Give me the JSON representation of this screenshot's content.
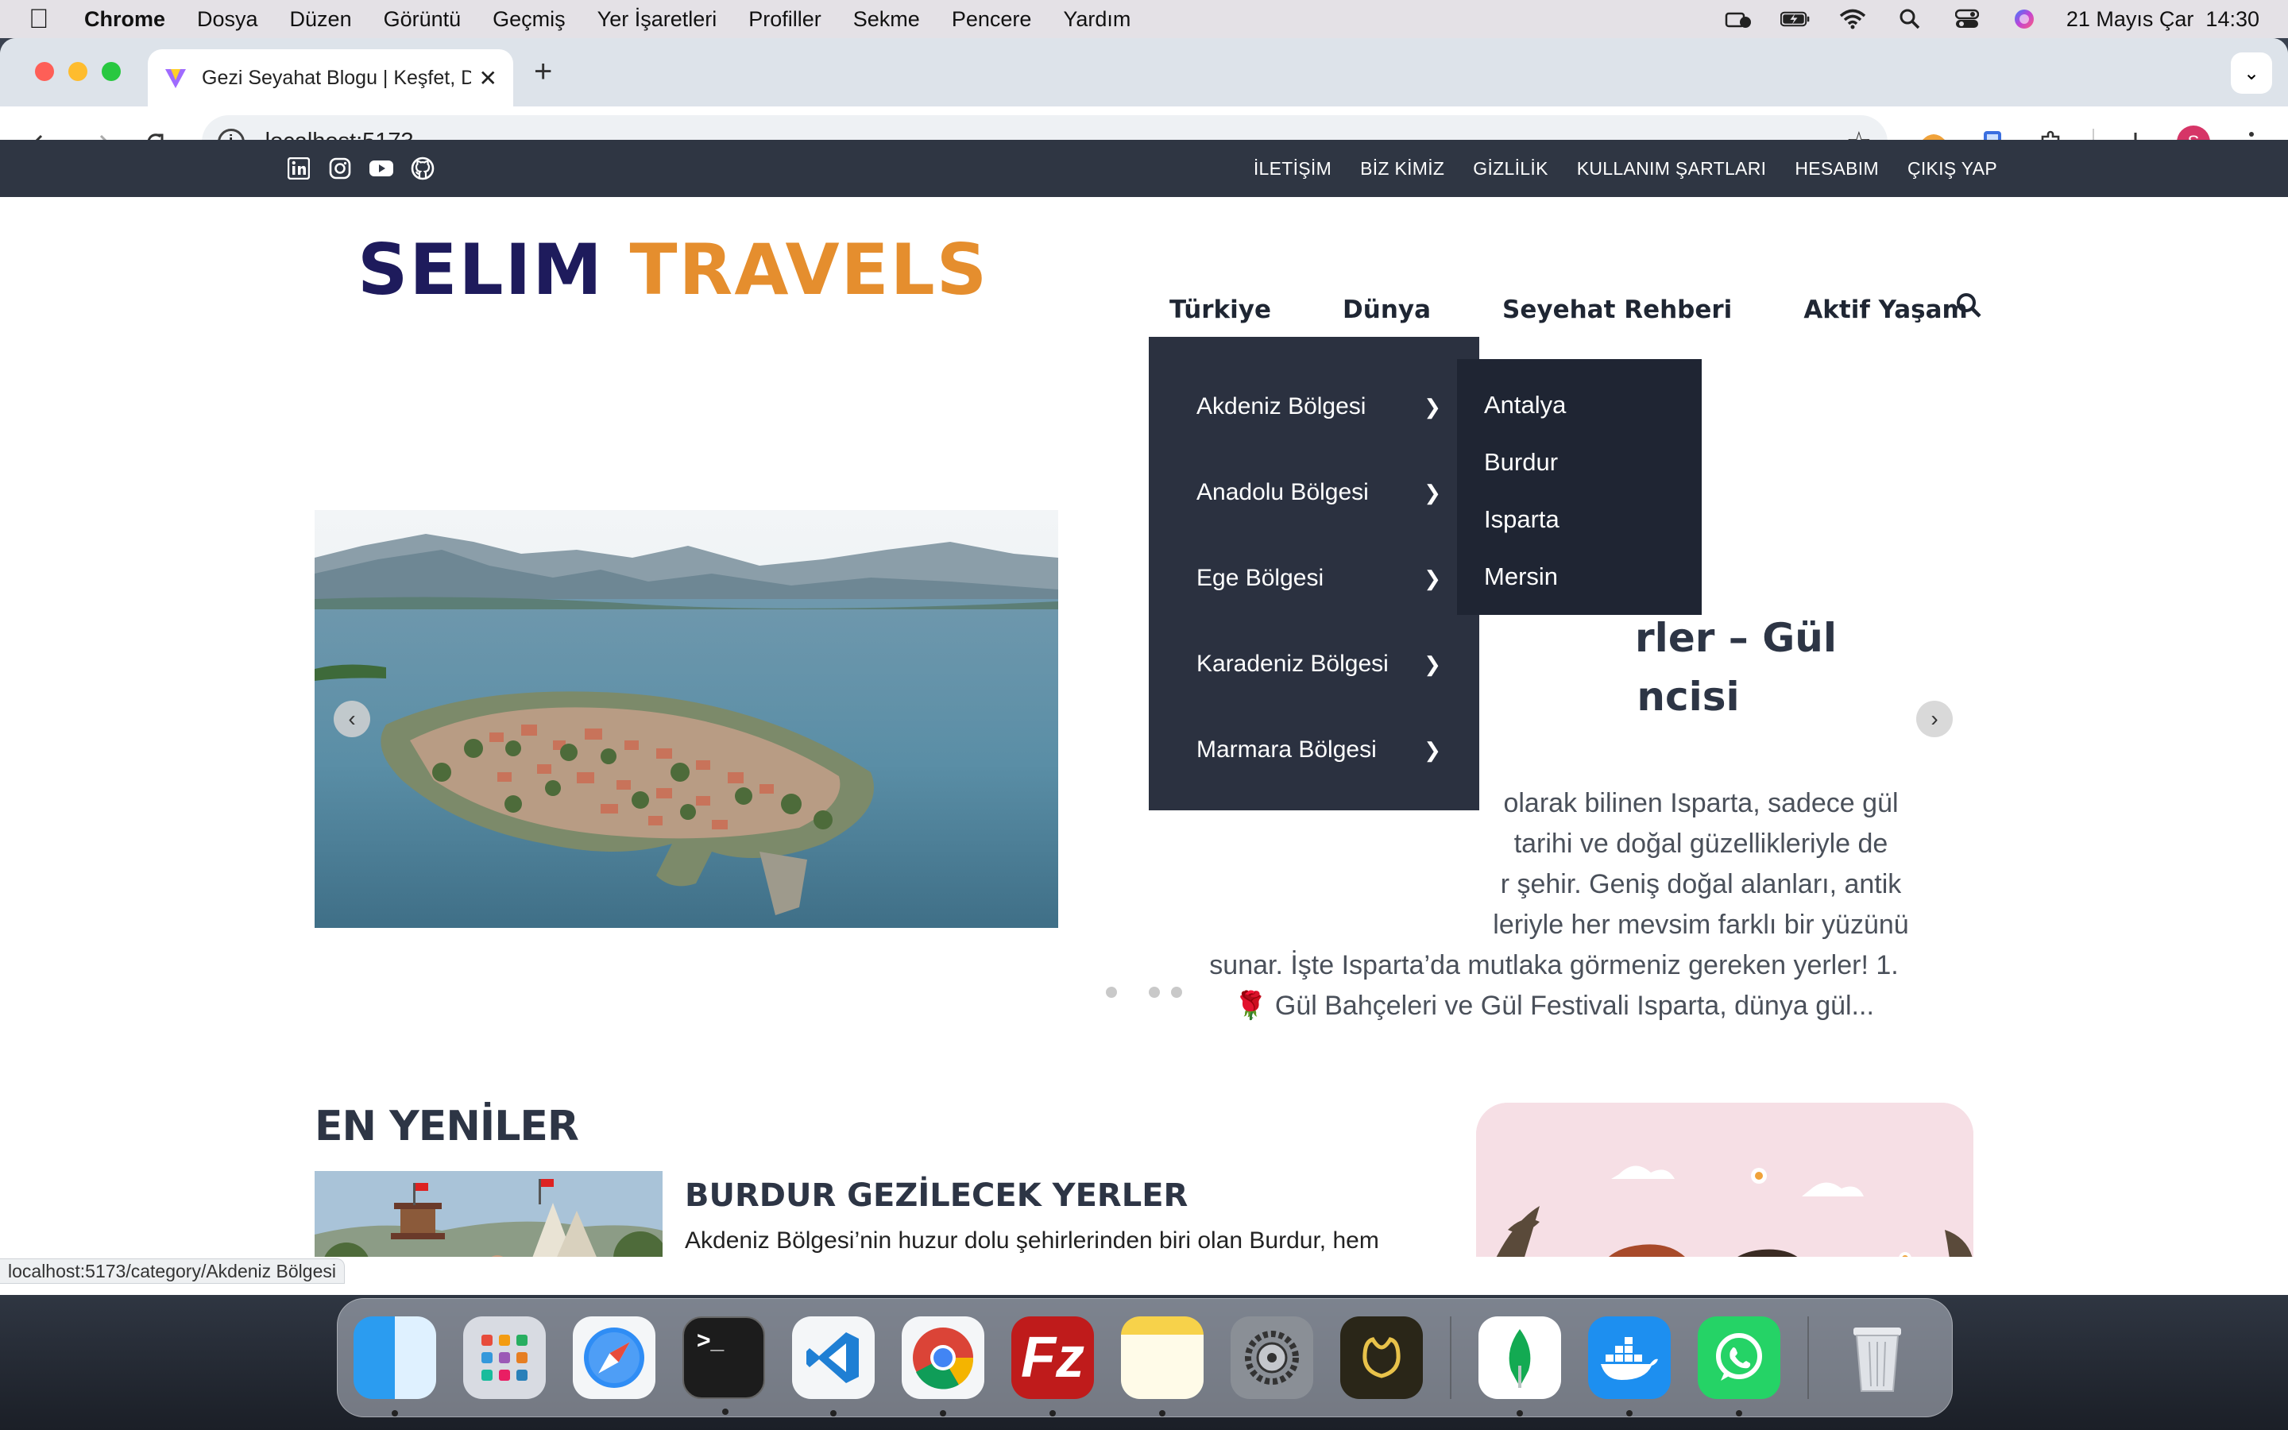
{
  "menubar": {
    "app": "Chrome",
    "items": [
      "Dosya",
      "Düzen",
      "Görüntü",
      "Geçmiş",
      "Yer İşaretleri",
      "Profiller",
      "Sekme",
      "Pencere",
      "Yardım"
    ],
    "clock": "21 Mayıs Çar  14:30"
  },
  "browser": {
    "tab_title": "Gezi Seyahat Blogu | Keşfet, D",
    "url": "localhost:5173",
    "profile_initial": "S",
    "status_url": "localhost:5173/category/Akdeniz Bölgesi"
  },
  "site": {
    "top_links": [
      "İLETİŞİM",
      "BİZ KİMİZ",
      "GİZLİLİK",
      "KULLANIM ŞARTLARI",
      "HESABIM",
      "ÇIKIŞ YAP"
    ],
    "logo_part1": "SELIM",
    "logo_part2": "TRAVELS",
    "nav": [
      "Türkiye",
      "Dünya",
      "Seyehat Rehberi",
      "Aktif Yaşam"
    ],
    "dropdown": [
      "Akdeniz Bölgesi",
      "Anadolu Bölgesi",
      "Ege Bölgesi",
      "Karadeniz Bölgesi",
      "Marmara Bölgesi"
    ],
    "submenu": [
      "Antalya",
      "Burdur",
      "Isparta",
      "Mersin"
    ],
    "hero": {
      "title_line1": "rler – Gül",
      "title_line2": "ncisi",
      "text_lines": [
        "olarak bilinen Isparta, sadece gül",
        "tarihi ve doğal güzellikleriyle de",
        "r şehir. Geniş doğal alanları, antik",
        "leriyle her mevsim farklı bir yüzünü",
        "sunar. İşte Isparta’da mutlaka görmeniz gereken yerler! 1.",
        "🌹 Gül Bahçeleri ve Gül Festivali Isparta, dünya gül..."
      ]
    },
    "section_title": "EN YENİLER",
    "latest": {
      "title": "BURDUR GEZİLECEK YERLER",
      "text": "Akdeniz Bölgesi’nin huzur dolu şehirlerinden biri olan Burdur, hem tarihi zenginlikleri hem de doğa harikalarıyla dikkat çeken,"
    }
  },
  "colors": {
    "topbar": "#2f3643",
    "logo_dark": "#1e1b5c",
    "logo_orange": "#e58e2e",
    "dropdown_bg": "#2b3140",
    "submenu_bg": "#1f2533"
  }
}
